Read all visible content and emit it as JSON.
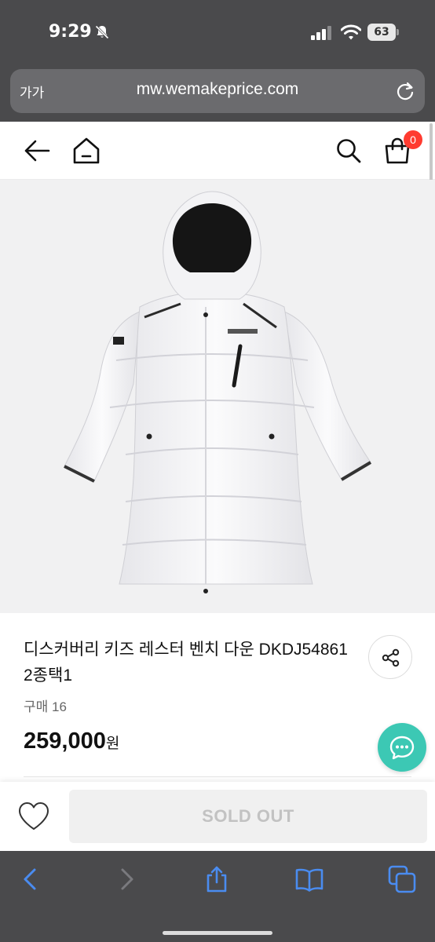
{
  "status_bar": {
    "time": "9:29",
    "battery": "63",
    "icons": [
      "bell-slash-icon",
      "cellular-signal-icon",
      "wifi-icon",
      "battery-icon"
    ]
  },
  "browser": {
    "text_size_label": "가가",
    "url": "mw.wemakeprice.com",
    "toolbar_icons": [
      "back-icon",
      "forward-icon",
      "share-icon",
      "bookmarks-icon",
      "tabs-icon"
    ]
  },
  "header": {
    "icons": [
      "back-arrow-icon",
      "home-icon",
      "search-icon",
      "cart-icon"
    ],
    "cart_count": "0"
  },
  "product": {
    "image_subject": "white long hooded padded down coat",
    "title": "디스커버리 키즈 레스터 벤치 다운 DKDJ54861 2종택1",
    "purchase_count": "구매 16",
    "price": "259,000",
    "price_unit": "원"
  },
  "actions": {
    "sold_out_label": "SOLD OUT",
    "icons": [
      "heart-icon",
      "share-icon",
      "chat-icon"
    ]
  },
  "colors": {
    "chrome": "#4a4a4c",
    "badge": "#ff3b30",
    "chat_button": "#3cc8b4",
    "browser_link": "#4a8cf0"
  }
}
